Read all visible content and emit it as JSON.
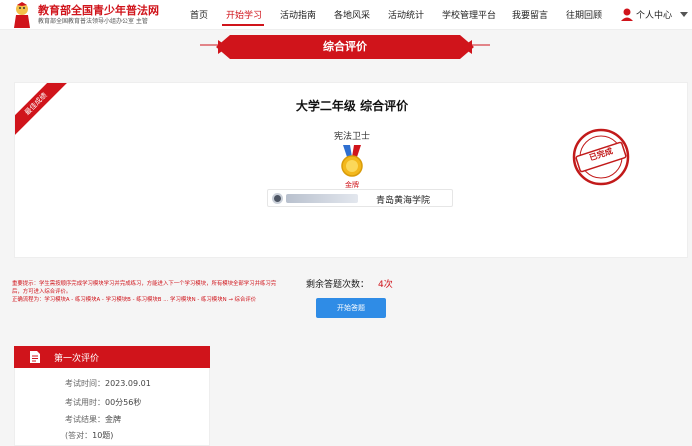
{
  "header": {
    "site_title": "教育部全国青少年普法网",
    "site_subtitle": "教育部全国教育普法领导小组办公室 主管",
    "nav": [
      "首页",
      "开始学习",
      "活动指南",
      "各地风采",
      "活动统计",
      "学校管理平台",
      "我要留言",
      "往期回顾"
    ],
    "active_index": 1,
    "user_label": "个人中心"
  },
  "banner": {
    "title": "综合评价"
  },
  "card": {
    "ribbon": "最佳成绩",
    "title": "大学二年级 综合评价",
    "topic": "宪法卫士",
    "medal": "金牌",
    "school": "青岛黄海学院",
    "stamp": "已完成"
  },
  "notice": {
    "line1": "重要提示：学生需按顺序完成学习模块学习并完成练习，方能进入下一个学习模块，所有模块全部学习并练习完后，方可进入综合评价。",
    "line2": "正确流程为：学习模块A - 练习模块A - 学习模块B - 练习模块B ... 学习模块N - 练习模块N → 综合评价"
  },
  "remaining": {
    "label": "剩余答题次数：",
    "count": "4次"
  },
  "start_button": "开始答题",
  "evaluation": {
    "title": "第一次评价",
    "rows": [
      {
        "key": "考试时间：",
        "value": "2023.09.01"
      },
      {
        "key": "考试用时：",
        "value": "00分56秒"
      },
      {
        "key": "考试结果：",
        "value": "金牌"
      },
      {
        "key": "(答对：",
        "value": "10题)"
      }
    ]
  },
  "colors": {
    "brand_red": "#d0141b",
    "button_blue": "#2f8ce6"
  }
}
